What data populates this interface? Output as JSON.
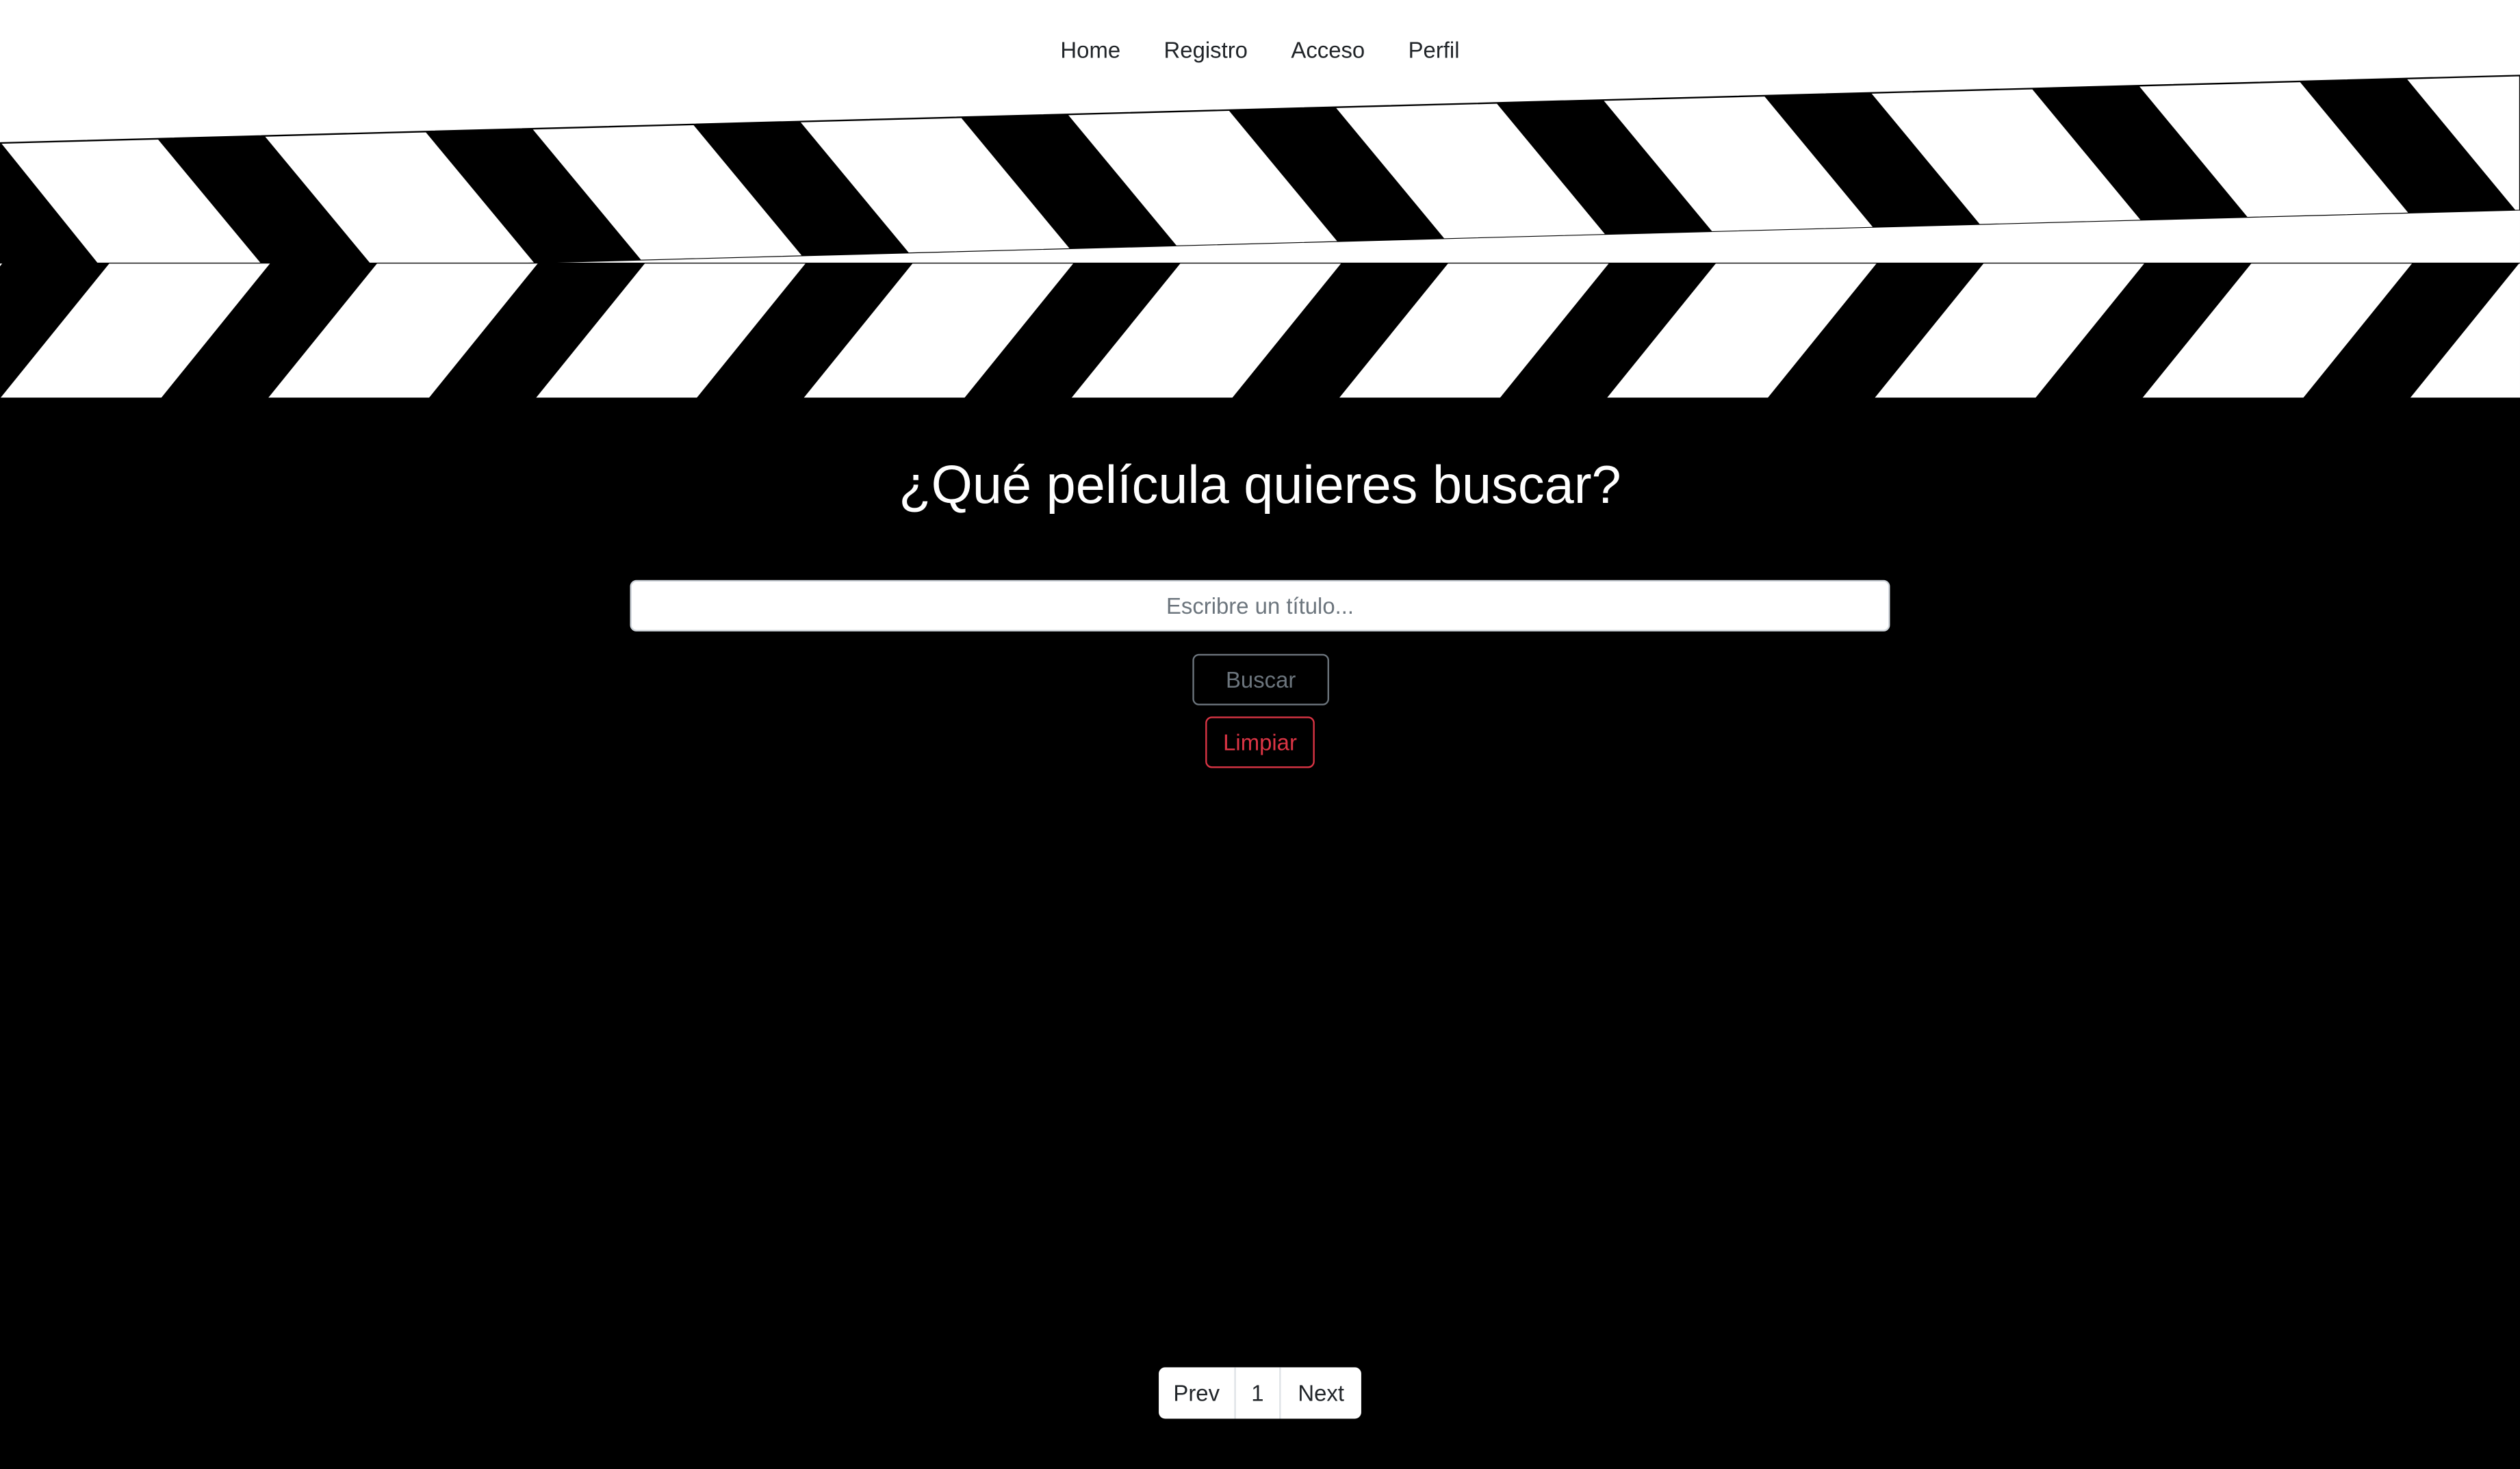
{
  "nav": {
    "links": [
      "Home",
      "Registro",
      "Acceso",
      "Perfil"
    ]
  },
  "hero": {
    "headline": "¿Qué película quieres buscar?"
  },
  "search": {
    "placeholder": "Escribre un título...",
    "value": "",
    "search_label": "Buscar",
    "clear_label": "Limpiar"
  },
  "pagination": {
    "prev_label": "Prev",
    "current_page": "1",
    "next_label": "Next"
  },
  "colors": {
    "background": "#000000",
    "stripe_light": "#ffffff",
    "stripe_dark": "#000000",
    "clear_button": "#dc3545",
    "search_button": "#6c757d"
  },
  "icons": [
    "clapperboard-banner"
  ]
}
